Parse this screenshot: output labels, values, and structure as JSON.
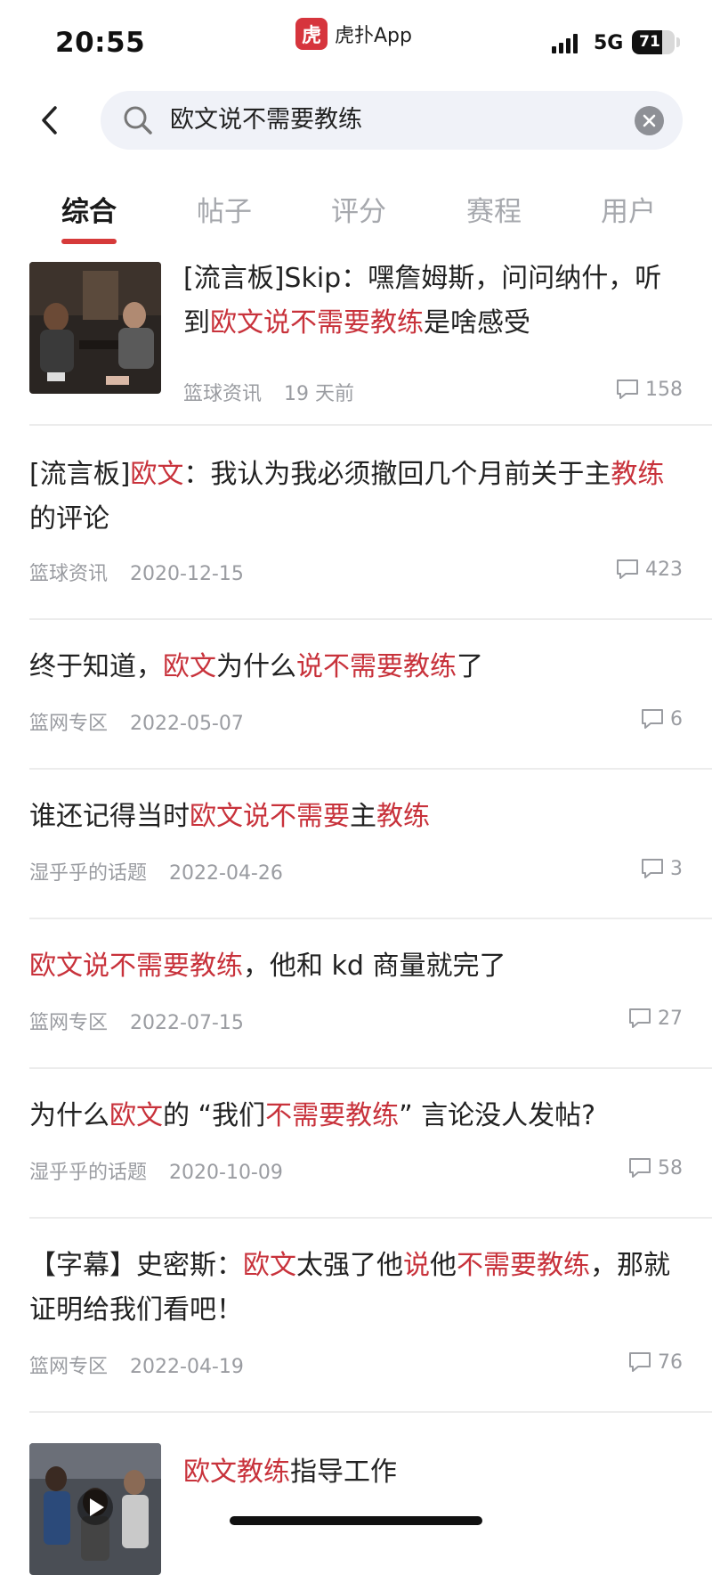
{
  "status_bar": {
    "time": "20:55",
    "app_logo_char": "虎",
    "app_name": "虎扑App",
    "network": "5G",
    "battery": "71",
    "battery_fraction": 0.71
  },
  "search": {
    "query": "欧文说不需要教练",
    "back_icon": "chevron-left-icon",
    "search_icon": "search-icon",
    "clear_icon": "clear-icon"
  },
  "tabs": [
    {
      "label": "综合",
      "active": true
    },
    {
      "label": "帖子",
      "active": false
    },
    {
      "label": "评分",
      "active": false
    },
    {
      "label": "赛程",
      "active": false
    },
    {
      "label": "用户",
      "active": false
    }
  ],
  "colors": {
    "accent": "#d63a3a",
    "highlight": "#c8323b",
    "meta": "#9a9ca1"
  },
  "results": [
    {
      "title_segments": [
        {
          "t": "[流言板]Skip：嘿詹姆斯，问问纳什，听到",
          "hl": false
        },
        {
          "t": "欧文说不需要教练",
          "hl": true
        },
        {
          "t": "是啥感受",
          "hl": false
        }
      ],
      "source": "篮球资讯",
      "date": "19 天前",
      "comments": "158",
      "has_thumbnail": true
    },
    {
      "title_segments": [
        {
          "t": "[流言板]",
          "hl": false
        },
        {
          "t": "欧文",
          "hl": true
        },
        {
          "t": "：我认为我必须撤回几个月前关于主",
          "hl": false
        },
        {
          "t": "教练",
          "hl": true
        },
        {
          "t": "的评论",
          "hl": false
        }
      ],
      "source": "篮球资讯",
      "date": "2020-12-15",
      "comments": "423"
    },
    {
      "title_segments": [
        {
          "t": "终于知道，",
          "hl": false
        },
        {
          "t": "欧文",
          "hl": true
        },
        {
          "t": "为什么",
          "hl": false
        },
        {
          "t": "说不需要教练",
          "hl": true
        },
        {
          "t": "了",
          "hl": false
        }
      ],
      "source": "篮网专区",
      "date": "2022-05-07",
      "comments": "6"
    },
    {
      "title_segments": [
        {
          "t": "谁还记得当时",
          "hl": false
        },
        {
          "t": "欧文说不需要",
          "hl": true
        },
        {
          "t": "主",
          "hl": false
        },
        {
          "t": "教练",
          "hl": true
        }
      ],
      "source": "湿乎乎的话题",
      "date": "2022-04-26",
      "comments": "3"
    },
    {
      "title_segments": [
        {
          "t": "欧文说不需要教练",
          "hl": true
        },
        {
          "t": "，他和 kd 商量就完了",
          "hl": false
        }
      ],
      "source": "篮网专区",
      "date": "2022-07-15",
      "comments": "27"
    },
    {
      "title_segments": [
        {
          "t": "为什么",
          "hl": false
        },
        {
          "t": "欧文",
          "hl": true
        },
        {
          "t": "的 “我们",
          "hl": false
        },
        {
          "t": "不需要教练",
          "hl": true
        },
        {
          "t": "” 言论没人发帖?",
          "hl": false
        }
      ],
      "source": "湿乎乎的话题",
      "date": "2020-10-09",
      "comments": "58"
    },
    {
      "title_segments": [
        {
          "t": "【字幕】史密斯：",
          "hl": false
        },
        {
          "t": "欧文",
          "hl": true
        },
        {
          "t": "太强了他",
          "hl": false
        },
        {
          "t": "说",
          "hl": true
        },
        {
          "t": "他",
          "hl": false
        },
        {
          "t": "不需要教练",
          "hl": true
        },
        {
          "t": "，那就证明给我们看吧！",
          "hl": false
        }
      ],
      "source": "篮网专区",
      "date": "2022-04-19",
      "comments": "76"
    },
    {
      "title_segments": [
        {
          "t": "欧文教练",
          "hl": true
        },
        {
          "t": "指导工作",
          "hl": false
        }
      ],
      "has_thumbnail": true,
      "thumbnail_kind": "video"
    }
  ]
}
